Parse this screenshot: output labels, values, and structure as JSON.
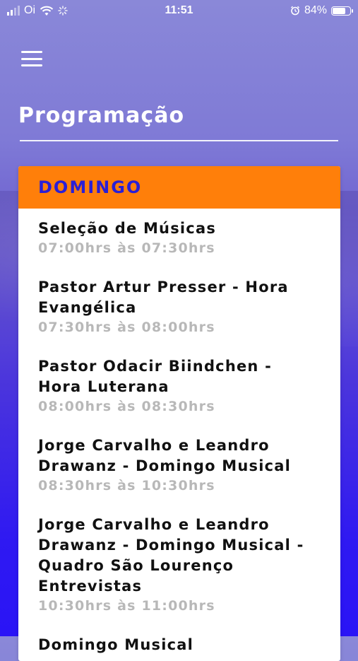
{
  "status_bar": {
    "carrier": "Oi",
    "time": "11:51",
    "battery": "84%",
    "battery_level": 0.84
  },
  "header": {
    "title": "Programação"
  },
  "schedule": {
    "day": "DOMINGO",
    "items": [
      {
        "title": "Seleção de Músicas",
        "time": "07:00hrs às 07:30hrs"
      },
      {
        "title": "Pastor Artur Presser - Hora Evangélica",
        "time": "07:30hrs às 08:00hrs"
      },
      {
        "title": "Pastor Odacir Biindchen - Hora Luterana",
        "time": "08:00hrs às 08:30hrs"
      },
      {
        "title": "Jorge Carvalho e Leandro Drawanz - Domingo Musical",
        "time": "08:30hrs às 10:30hrs"
      },
      {
        "title": "Jorge Carvalho e Leandro Drawanz - Domingo Musical - Quadro São Lourenço Entrevistas",
        "time": "10:30hrs às 11:00hrs"
      },
      {
        "title": "Domingo Musical",
        "time": ""
      }
    ]
  },
  "colors": {
    "header_bg": "#ff7f0a",
    "day_text": "#2a1fd6",
    "time_text": "#b8b8b8"
  }
}
